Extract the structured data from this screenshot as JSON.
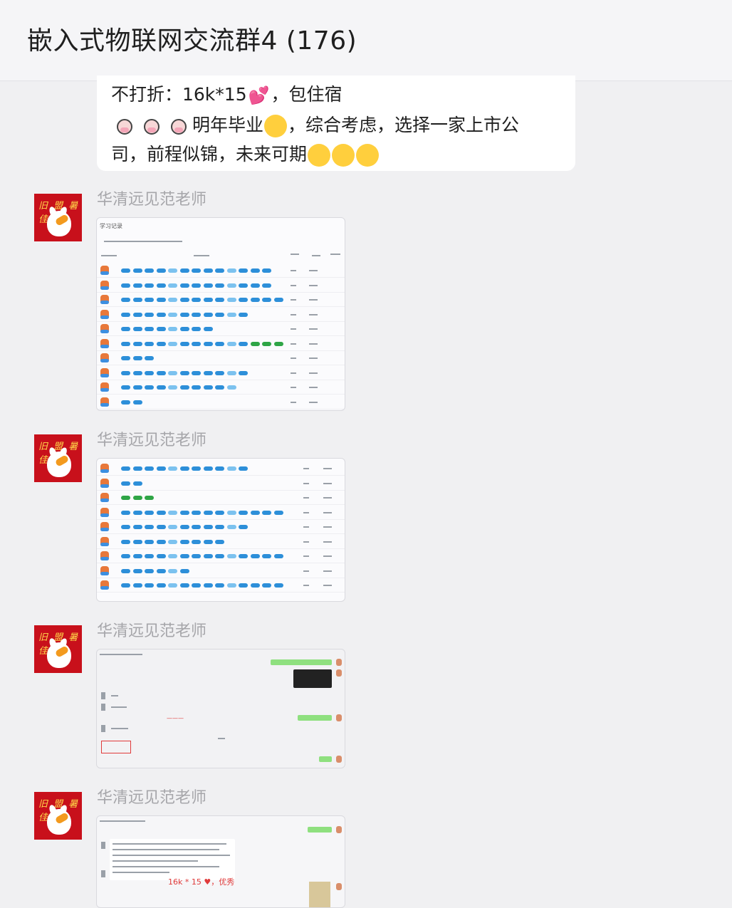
{
  "header": {
    "title": "嵌入式物联网交流群4 (176)"
  },
  "message_bubble": {
    "line1_text": "不打折：16k*15",
    "line1_suffix": "，包住宿",
    "line2_text": "明年毕业",
    "line2_suffix": "，综合考虑，选择一家上市公",
    "line3_text": "司，前程似锦，未来可期"
  },
  "avatar": {
    "text": "旧 盟 暑 佳"
  },
  "messages": [
    {
      "sender": "华清远见范老师"
    },
    {
      "sender": "华清远见范老师"
    },
    {
      "sender": "华清远见范老师"
    },
    {
      "sender": "华清远见范老师"
    }
  ],
  "shots": {
    "shot1_title": "学习记录",
    "shot4_red_text": "16k * 15 ♥，优秀"
  },
  "icons": {
    "heart": "sparkling-heart",
    "cow": "cow-face",
    "thinking": "thinking-face",
    "blessing": "face-with-hand-over-mouth"
  },
  "colors": {
    "accent_blue": "#2d8fd9",
    "green": "#2fa546",
    "avatar_red": "#c8101b"
  }
}
